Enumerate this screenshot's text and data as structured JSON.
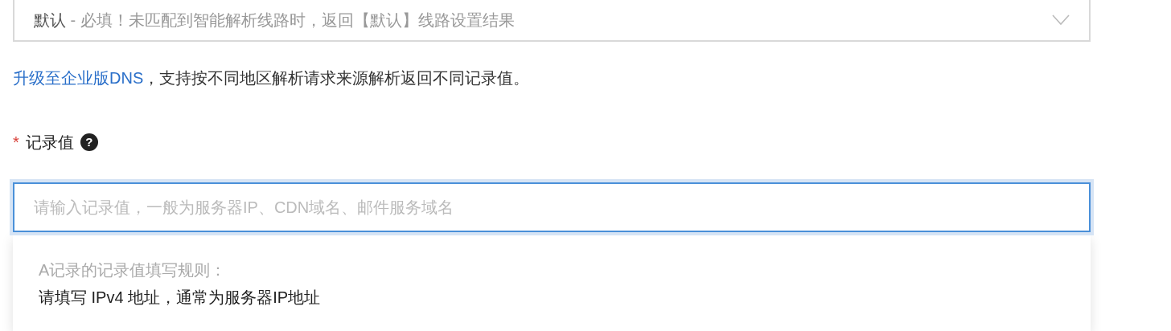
{
  "line_select": {
    "value": "默认",
    "hint": " - 必填！未匹配到智能解析线路时，返回【默认】线路设置结果"
  },
  "upgrade_note": {
    "link": "升级至企业版DNS",
    "text": "，支持按不同地区解析请求来源解析返回不同记录值。"
  },
  "record_field": {
    "required_mark": "*",
    "label": "记录值",
    "help_glyph": "?",
    "placeholder": "请输入记录值，一般为服务器IP、CDN域名、邮件服务域名",
    "focused": true
  },
  "rule_popup": {
    "title": "A记录的记录值填写规则：",
    "body": "请填写 IPv4 地址，通常为服务器IP地址"
  }
}
